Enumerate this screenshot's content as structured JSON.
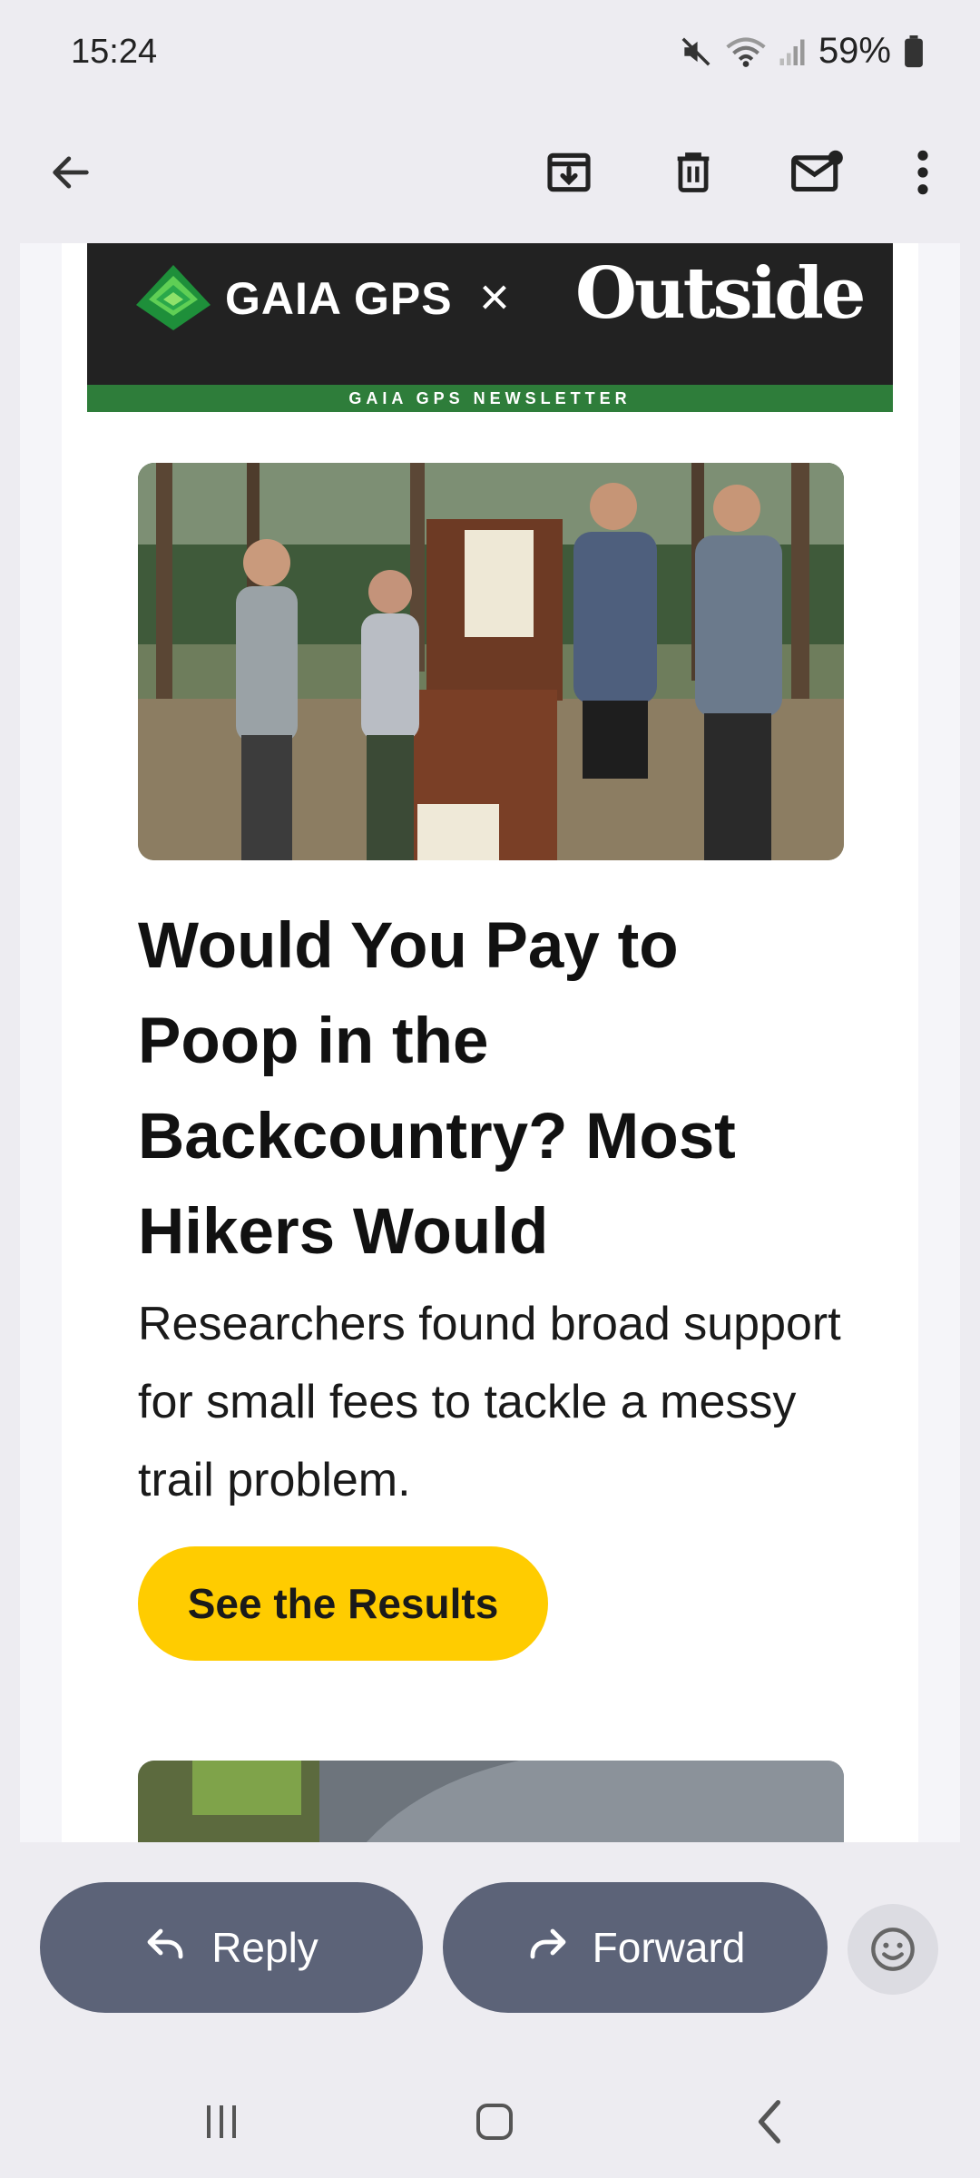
{
  "status_bar": {
    "time": "15:24",
    "battery": "59%",
    "icons": [
      "mute-icon",
      "wifi-icon",
      "signal-icon",
      "battery-icon"
    ]
  },
  "toolbar": {
    "icons": [
      "back-arrow-icon",
      "archive-icon",
      "delete-icon",
      "mark-unread-icon",
      "more-options-icon"
    ]
  },
  "email": {
    "banner": {
      "brand_left": "GAIA GPS",
      "separator": "×",
      "brand_right": "Outside",
      "strip_label": "GAIA GPS NEWSLETTER",
      "accent_color": "#2e7d3a"
    },
    "article": {
      "headline": "Would You Pay to Poop in the Backcountry? Most Hikers Would",
      "subtext": "Researchers found broad support for small fees to tackle a messy trail problem.",
      "cta_label": "See the Results",
      "cta_color": "#ffcc00"
    }
  },
  "reply_bar": {
    "reply_label": "Reply",
    "forward_label": "Forward",
    "emoji_icon": "smiley-icon",
    "button_color": "#5c6378"
  },
  "nav_bar": {
    "icons": [
      "recents-icon",
      "home-icon",
      "back-icon"
    ]
  }
}
